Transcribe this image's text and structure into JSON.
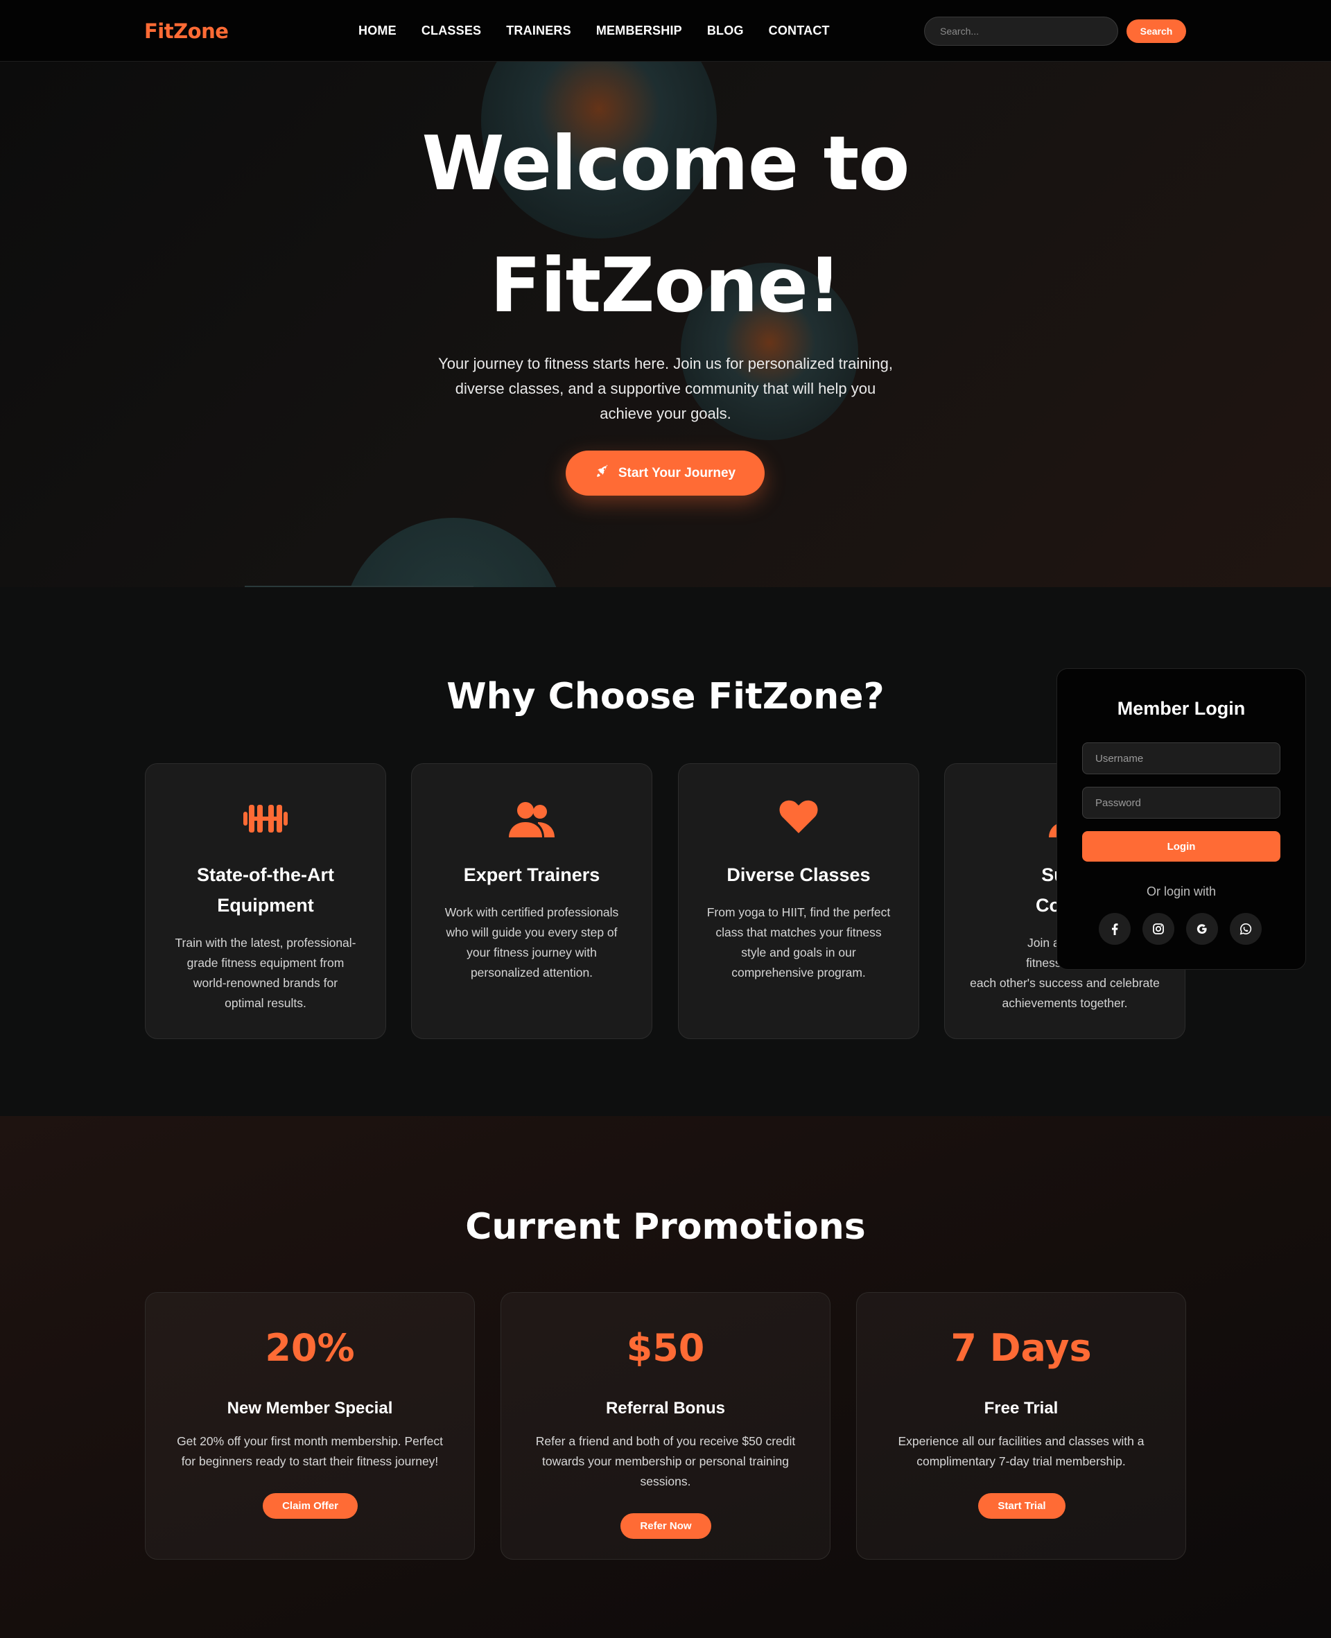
{
  "brand": {
    "logo": "FitZone",
    "accent_color": "#ff6b35"
  },
  "nav": {
    "links": [
      "HOME",
      "CLASSES",
      "TRAINERS",
      "MEMBERSHIP",
      "BLOG",
      "CONTACT"
    ],
    "search_placeholder": "Search...",
    "search_button": "Search"
  },
  "hero": {
    "title_line1": "Welcome to",
    "title_line2": "FitZone!",
    "subtitle_line1": "Your journey to fitness starts here. Join us for personalized training,",
    "subtitle_line2": "diverse classes, and a supportive community that will help you",
    "subtitle_line3": "achieve your goals.",
    "cta_label": "Start Your Journey",
    "cta_icon": "rocket-icon"
  },
  "features": {
    "title": "Why Choose FitZone?",
    "items": [
      {
        "icon": "dumbbell-icon",
        "title_line1": "State-of-the-Art",
        "title_line2": "Equipment",
        "text_line1": "Train with the latest, professional-",
        "text_line2": "grade fitness equipment from",
        "text_line3": "world-renowned brands for",
        "text_line4": "optimal results."
      },
      {
        "icon": "users-icon",
        "title_line1": "Expert Trainers",
        "title_line2": "",
        "text_line1": "Work with certified professionals",
        "text_line2": "who will guide you every step of",
        "text_line3": "your fitness journey with",
        "text_line4": "personalized attention."
      },
      {
        "icon": "heart-icon",
        "title_line1": "Diverse Classes",
        "title_line2": "",
        "text_line1": "From yoga to HIIT, find the perfect",
        "text_line2": "class that matches your fitness",
        "text_line3": "style and goals in our",
        "text_line4": "comprehensive program."
      },
      {
        "icon": "community-icon",
        "title_line1": "Supp",
        "title_line2": "Comm",
        "text_line1": "Join a motivat",
        "text_line2": "fitness enthusi",
        "text_line3": "each other's success and celebrate",
        "text_line4": "achievements together."
      }
    ]
  },
  "login": {
    "title": "Member Login",
    "username_placeholder": "Username",
    "password_placeholder": "Password",
    "login_button": "Login",
    "alt_text": "Or login with",
    "socials": [
      "facebook-icon",
      "instagram-icon",
      "google-icon",
      "whatsapp-icon"
    ]
  },
  "promotions": {
    "title": "Current Promotions",
    "items": [
      {
        "big": "20%",
        "title": "New Member Special",
        "text_line1": "Get 20% off your first month membership. Perfect",
        "text_line2": "for beginners ready to start their fitness journey!",
        "text_line3": "",
        "button": "Claim Offer"
      },
      {
        "big": "$50",
        "title": "Referral Bonus",
        "text_line1": "Refer a friend and both of you receive $50 credit",
        "text_line2": "towards your membership or personal training",
        "text_line3": "sessions.",
        "button": "Refer Now"
      },
      {
        "big": "7 Days",
        "title": "Free Trial",
        "text_line1": "Experience all our facilities and classes with a",
        "text_line2": "complimentary 7-day trial membership.",
        "text_line3": "",
        "button": "Start Trial"
      }
    ]
  }
}
